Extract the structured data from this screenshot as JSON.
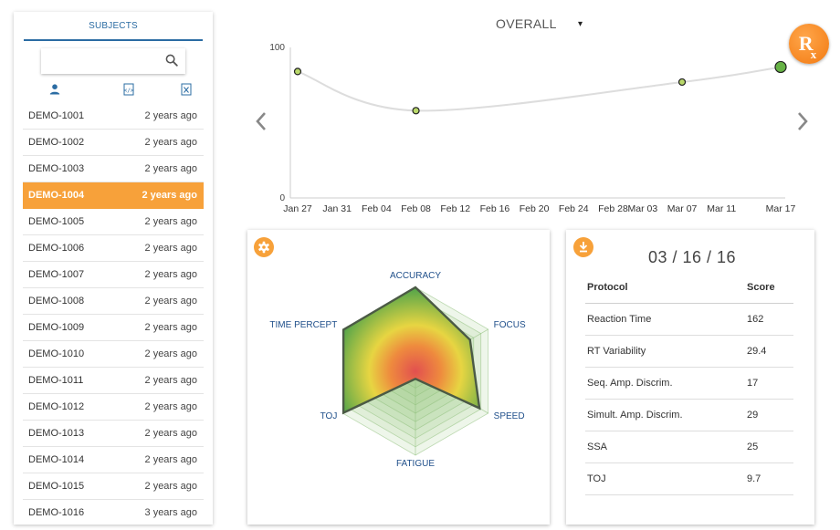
{
  "sidebar": {
    "header": "SUBJECTS",
    "search": {
      "value": "",
      "placeholder": ""
    },
    "filters": [
      "person-icon",
      "code-file-icon",
      "excel-file-icon"
    ],
    "subjects": [
      {
        "id": "DEMO-1001",
        "time": "2 years ago",
        "active": false
      },
      {
        "id": "DEMO-1002",
        "time": "2 years ago",
        "active": false
      },
      {
        "id": "DEMO-1003",
        "time": "2 years ago",
        "active": false
      },
      {
        "id": "DEMO-1004",
        "time": "2 years ago",
        "active": true
      },
      {
        "id": "DEMO-1005",
        "time": "2 years ago",
        "active": false
      },
      {
        "id": "DEMO-1006",
        "time": "2 years ago",
        "active": false
      },
      {
        "id": "DEMO-1007",
        "time": "2 years ago",
        "active": false
      },
      {
        "id": "DEMO-1008",
        "time": "2 years ago",
        "active": false
      },
      {
        "id": "DEMO-1009",
        "time": "2 years ago",
        "active": false
      },
      {
        "id": "DEMO-1010",
        "time": "2 years ago",
        "active": false
      },
      {
        "id": "DEMO-1011",
        "time": "2 years ago",
        "active": false
      },
      {
        "id": "DEMO-1012",
        "time": "2 years ago",
        "active": false
      },
      {
        "id": "DEMO-1013",
        "time": "2 years ago",
        "active": false
      },
      {
        "id": "DEMO-1014",
        "time": "2 years ago",
        "active": false
      },
      {
        "id": "DEMO-1015",
        "time": "2 years ago",
        "active": false
      },
      {
        "id": "DEMO-1016",
        "time": "3 years ago",
        "active": false
      }
    ]
  },
  "header": {
    "metric_select": "OVERALL",
    "caret": "▾",
    "badge": {
      "main": "R",
      "sub": "x"
    }
  },
  "chart_data": {
    "type": "line",
    "categories": [
      "Jan 27",
      "Jan 31",
      "Feb 04",
      "Feb 08",
      "Feb 12",
      "Feb 16",
      "Feb 20",
      "Feb 24",
      "Feb 28",
      "Mar 03",
      "Mar 07",
      "Mar 11",
      "Mar 17"
    ],
    "ylim": [
      0,
      100
    ],
    "yticks": [
      "100",
      "0"
    ],
    "points": [
      {
        "x": "Jan 27",
        "y": 84
      },
      {
        "x": "Feb 08",
        "y": 58
      },
      {
        "x": "Mar 07",
        "y": 77
      },
      {
        "x": "Mar 17",
        "y": 87
      }
    ],
    "grid": false,
    "colors": {
      "line": "#dddddd",
      "point": "#b9d86a",
      "last_point": "#66b245"
    }
  },
  "radar": {
    "settings_icon": "gear-icon",
    "axes": [
      {
        "label": "ACCURACY",
        "value": 1.0
      },
      {
        "label": "FOCUS",
        "value": 0.75
      },
      {
        "label": "SPEED",
        "value": 0.88
      },
      {
        "label": "FATIGUE",
        "value": 0.09
      },
      {
        "label": "TOJ",
        "value": 0.99
      },
      {
        "label": "TIME PERCEPT",
        "value": 0.99
      }
    ],
    "levels": 10
  },
  "scores": {
    "download_icon": "download-icon",
    "date": "03 / 16 / 16",
    "headers": {
      "protocol": "Protocol",
      "score": "Score"
    },
    "rows": [
      {
        "protocol": "Reaction Time",
        "score": "162"
      },
      {
        "protocol": "RT Variability",
        "score": "29.4"
      },
      {
        "protocol": "Seq. Amp. Discrim.",
        "score": "17"
      },
      {
        "protocol": "Simult. Amp. Discrim.",
        "score": "29"
      },
      {
        "protocol": "SSA",
        "score": "25"
      },
      {
        "protocol": "TOJ",
        "score": "9.7"
      }
    ]
  },
  "colors": {
    "accent": "#f7a13a",
    "primary": "#2b6ca3"
  }
}
